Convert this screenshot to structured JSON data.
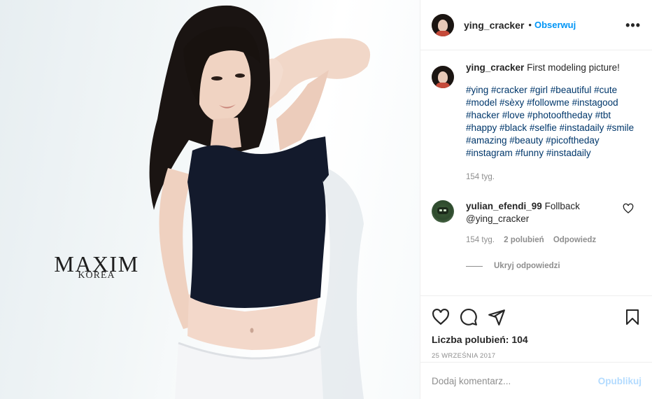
{
  "media": {
    "logo_word": "MAXIM",
    "logo_sub": "KOREA"
  },
  "header": {
    "username": "ying_cracker",
    "separator": "•",
    "follow_label": "Obserwuj",
    "more_label": "•••"
  },
  "caption": {
    "username": "ying_cracker",
    "text": "First modeling picture!",
    "hashtags": "#ying #cracker #girl #beautiful #cute #model #sèxy #followme #instagood #hacker #love #photooftheday #tbt #happy #black #selfie #instadaily #smile #amazing #beauty #picoftheday #instagram #funny #instadaily",
    "time": "154 tyg."
  },
  "comment": {
    "username": "yulian_efendi_99",
    "text": "Follback",
    "mention": "@ying_cracker",
    "time": "154 tyg.",
    "likes": "2 polubień",
    "reply_label": "Odpowiedz",
    "hide_replies": "Ukryj odpowiedzi"
  },
  "actions": {
    "likes_text": "Liczba polubień: 104",
    "date": "25 WRZEŚNIA 2017"
  },
  "add_comment": {
    "placeholder": "Dodaj komentarz...",
    "post_label": "Opublikuj"
  },
  "colors": {
    "accent": "#0095f6",
    "hashtag": "#00376b",
    "muted": "#8e8e8e",
    "post_disabled": "#b3dbff"
  }
}
